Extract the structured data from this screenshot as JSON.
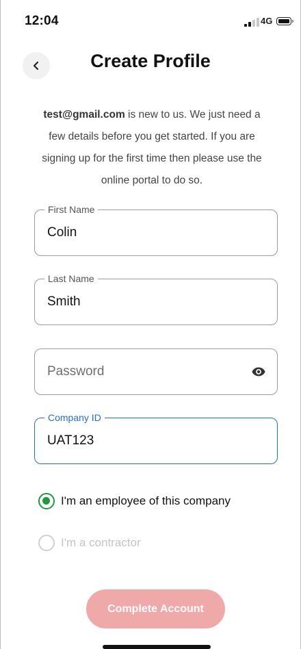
{
  "status_bar": {
    "time": "12:04",
    "network": "4G"
  },
  "header": {
    "title": "Create Profile"
  },
  "intro": {
    "email": "test@gmail.com",
    "message": " is new to us. We just need a few details before you get started. If you are signing up for the first time then please use the online portal to do so."
  },
  "form": {
    "first_name": {
      "label": "First Name",
      "value": "Colin"
    },
    "last_name": {
      "label": "Last Name",
      "value": "Smith"
    },
    "password": {
      "placeholder": "Password",
      "value": ""
    },
    "company_id": {
      "label": "Company ID",
      "value": "UAT123"
    }
  },
  "roles": [
    {
      "label": "I'm an employee of this company",
      "selected": true
    },
    {
      "label": "I'm a contractor",
      "selected": false
    }
  ],
  "cta": {
    "label": "Complete Account"
  },
  "icons": {
    "back": "chevron-left-icon",
    "eye": "eye-icon",
    "battery": "battery-icon",
    "signal": "signal-icon"
  },
  "colors": {
    "accent": "#1f6fd6",
    "radio_selected": "#1e9a3b",
    "cta_background": "#f0a9a9"
  }
}
